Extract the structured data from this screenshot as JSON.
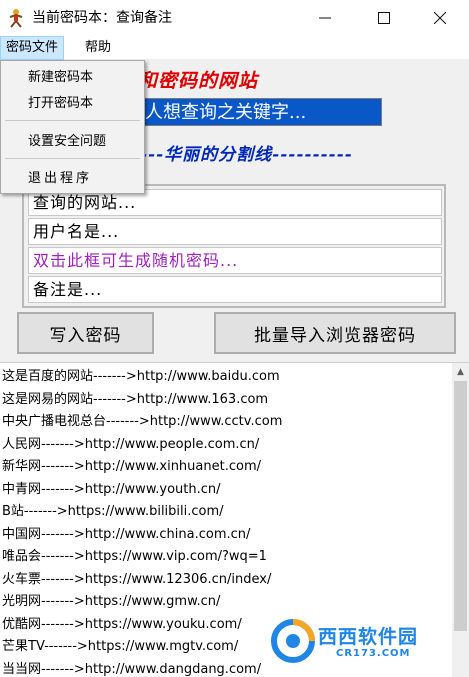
{
  "window": {
    "title": "当前密码本：查询备注",
    "minimize_glyph": "—",
    "maximize_glyph": "☐",
    "close_glyph": "✕",
    "icon": "app-figure-icon"
  },
  "menubar": {
    "file_label": "密码文件",
    "help_label": "帮助"
  },
  "file_menu": {
    "new_label": "新建密码本",
    "open_label": "打开密码本",
    "security_label": "设置安全问题",
    "exit_label": "退出程序"
  },
  "form": {
    "banner_visible": "要查询用户名和密码的网站",
    "search_value": "人想查询之关键字...",
    "divider_visible": "---华丽的分割线----------",
    "site_field": "查询的网站...",
    "user_field": "用户名是...",
    "password_field": "双击此框可生成随机密码...",
    "note_field": "备注是...",
    "write_button": "写入密码",
    "import_button": "批量导入浏览器密码"
  },
  "list": {
    "rows": [
      "这是百度的网站------->http://www.baidu.com",
      "这是网易的网站------->http://www.163.com",
      "中央广播电视总台------->http://www.cctv.com",
      "人民网------->http://www.people.com.cn/",
      "新华网------->http://www.xinhuanet.com/",
      "中青网------->http://www.youth.cn/",
      "B站------->https://www.bilibili.com/",
      "中国网------->http://www.china.com.cn/",
      "唯品会------->https://www.vip.com/?wq=1",
      "火车票------->https://www.12306.cn/index/",
      "光明网------->https://www.gmw.cn/",
      "优酷网------->https://www.youku.com/",
      "芒果TV------->https://www.mgtv.com/",
      "当当网------->http://www.dangdang.com/"
    ]
  },
  "watermark": {
    "brand": "西西软件园",
    "domain": "CR173.COM",
    "color": "#1f86e6"
  },
  "colors": {
    "selection_blue": "#0a58c8",
    "banner_red": "#e00000",
    "divider_blue": "#0028b8",
    "password_purple": "#a020c0",
    "menu_highlight": "#cce8ff"
  }
}
